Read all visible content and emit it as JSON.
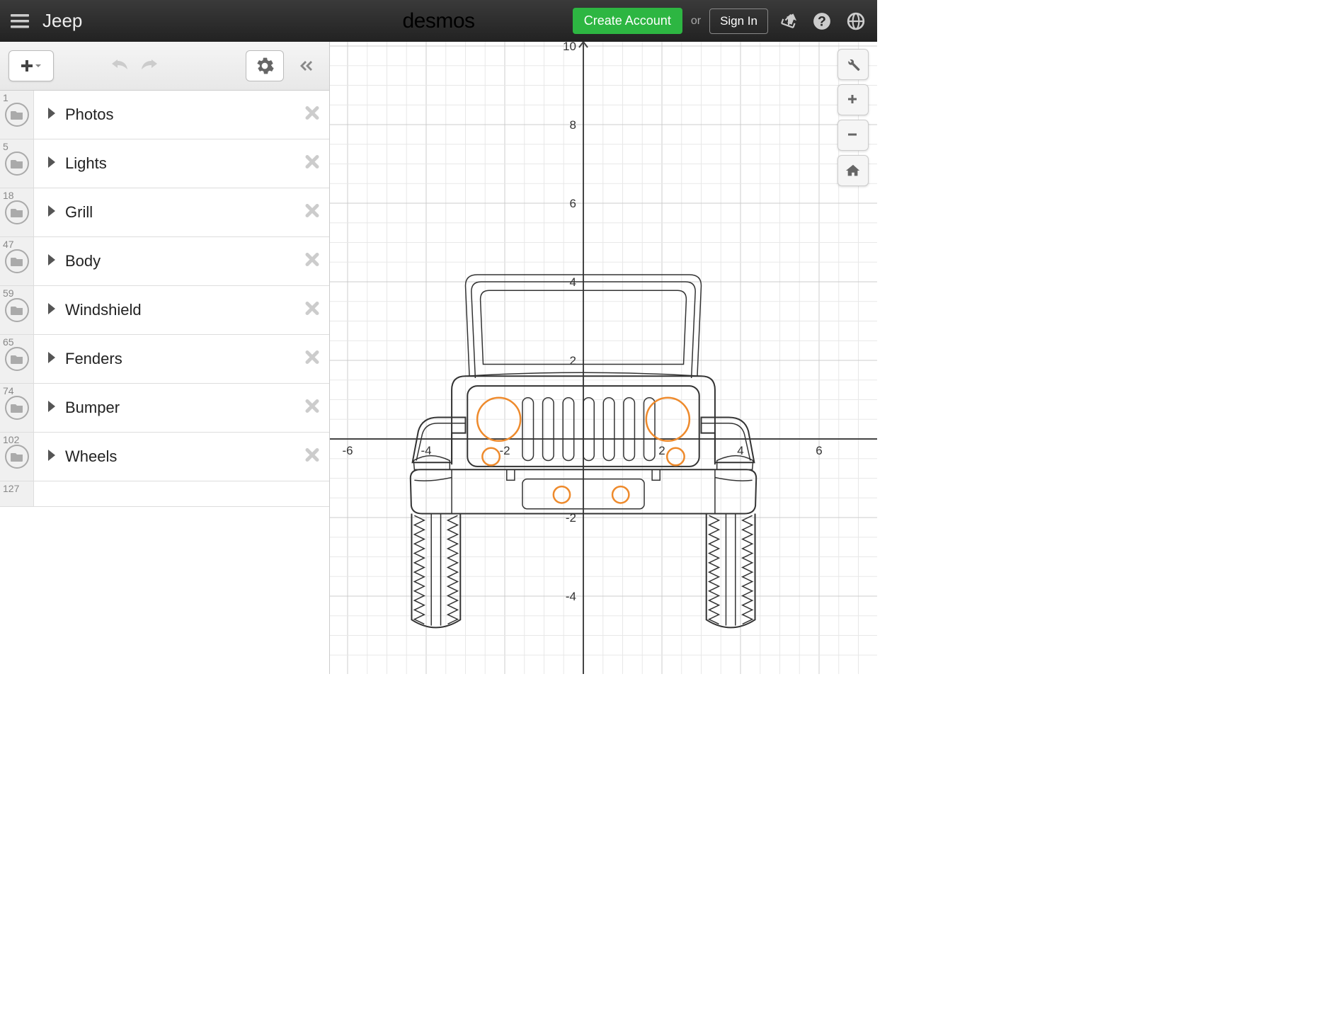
{
  "header": {
    "title": "Jeep",
    "logo": "desmos",
    "create_account": "Create Account",
    "or": "or",
    "sign_in": "Sign In"
  },
  "sidebar": {
    "folders": [
      {
        "num": "1",
        "name": "Photos"
      },
      {
        "num": "5",
        "name": "Lights"
      },
      {
        "num": "18",
        "name": "Grill"
      },
      {
        "num": "47",
        "name": "Body"
      },
      {
        "num": "59",
        "name": "Windshield"
      },
      {
        "num": "65",
        "name": "Fenders"
      },
      {
        "num": "74",
        "name": "Bumper"
      },
      {
        "num": "102",
        "name": "Wheels"
      }
    ],
    "end_num": "127"
  },
  "graph": {
    "x_ticks": [
      "-6",
      "-4",
      "-2",
      "2",
      "4",
      "6"
    ],
    "y_ticks": [
      "-4",
      "-2",
      "2",
      "4",
      "6",
      "8",
      "10"
    ]
  }
}
